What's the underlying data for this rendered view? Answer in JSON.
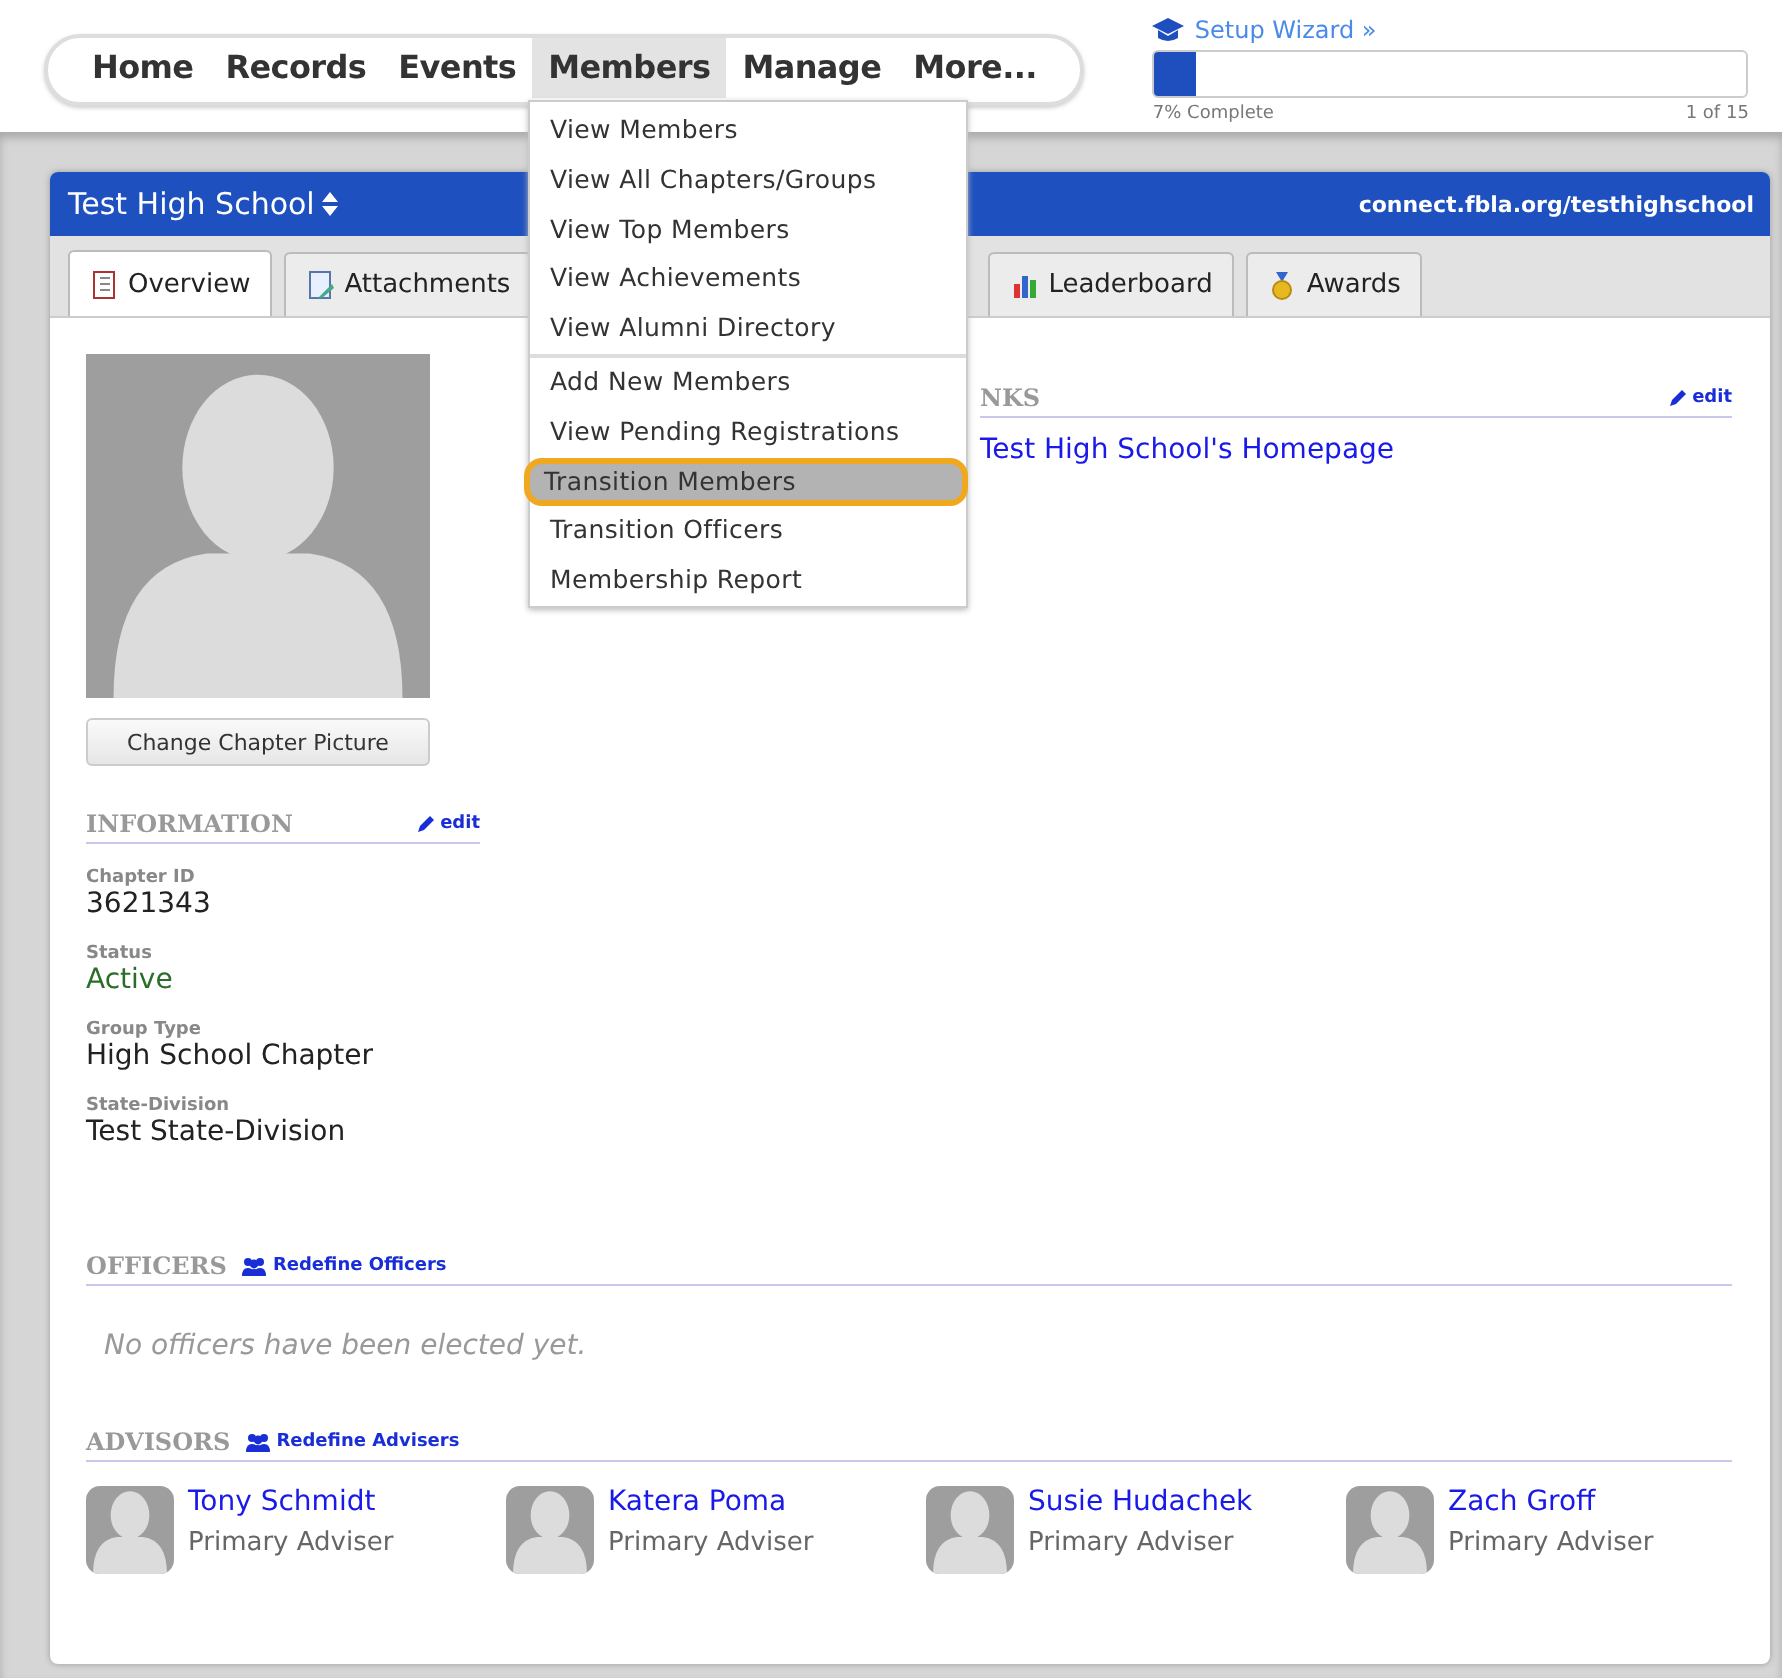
{
  "nav": {
    "items": [
      {
        "label": "Home",
        "selected": false
      },
      {
        "label": "Records",
        "selected": false
      },
      {
        "label": "Events",
        "selected": false
      },
      {
        "label": "Members",
        "selected": true
      },
      {
        "label": "Manage",
        "selected": false
      },
      {
        "label": "More..."
      }
    ]
  },
  "setup_wizard": {
    "link": "Setup Wizard »",
    "level": 0.07,
    "progress_text": "7% Complete",
    "step": "1 of 15"
  },
  "members_menu": {
    "groups": [
      [
        {
          "label": "View Members",
          "selected": false
        },
        {
          "label": "View All Chapters/Groups",
          "selected": false
        },
        {
          "label": "View Top Members",
          "selected": false
        },
        {
          "label": "View Achievements",
          "selected": false
        },
        {
          "label": "View Alumni Directory",
          "selected": false
        }
      ],
      [
        {
          "label": "Add New Members",
          "selected": false
        },
        {
          "label": "View Pending Registrations",
          "selected": false
        },
        {
          "label": "Transition Members",
          "selected": true
        },
        {
          "label": "Transition Officers",
          "selected": false
        },
        {
          "label": "Membership Report",
          "selected": false
        }
      ]
    ]
  },
  "chapter": {
    "title": "Test High School",
    "url": "connect.fbla.org/testhighschool"
  },
  "tabs": [
    {
      "label": "Overview",
      "selected": true,
      "kind": "book"
    },
    {
      "label": "Attachments",
      "selected": false,
      "kind": "doc"
    },
    {
      "label": "Leaderboard",
      "selected": false,
      "kind": "chart"
    },
    {
      "label": "Awards",
      "selected": false,
      "kind": "medal"
    }
  ],
  "picture_button": "Change Chapter Picture",
  "information": {
    "heading": "INFORMATION",
    "edit": "edit",
    "fields": [
      {
        "label": "Chapter ID",
        "value": "3621343",
        "kind": "plain"
      },
      {
        "label": "Status",
        "value": "Active",
        "kind": "status"
      },
      {
        "label": "Group Type",
        "value": "High School Chapter",
        "kind": "plain"
      },
      {
        "label": "State-Division",
        "value": "Test State-Division",
        "kind": "plain"
      }
    ]
  },
  "links": {
    "heading": "NKS",
    "edit": "edit",
    "items": [
      "Test High School's Homepage"
    ]
  },
  "officers": {
    "heading": "OFFICERS",
    "action": "Redefine Officers",
    "empty": "No officers have been elected yet."
  },
  "advisors": {
    "heading": "ADVISORS",
    "action": "Redefine Advisers",
    "people": [
      {
        "name": "Tony Schmidt",
        "role": "Primary Adviser"
      },
      {
        "name": "Katera Poma",
        "role": "Primary Adviser"
      },
      {
        "name": "Susie Hudachek",
        "role": "Primary Adviser"
      },
      {
        "name": "Zach Groff",
        "role": "Primary Adviser"
      }
    ]
  }
}
